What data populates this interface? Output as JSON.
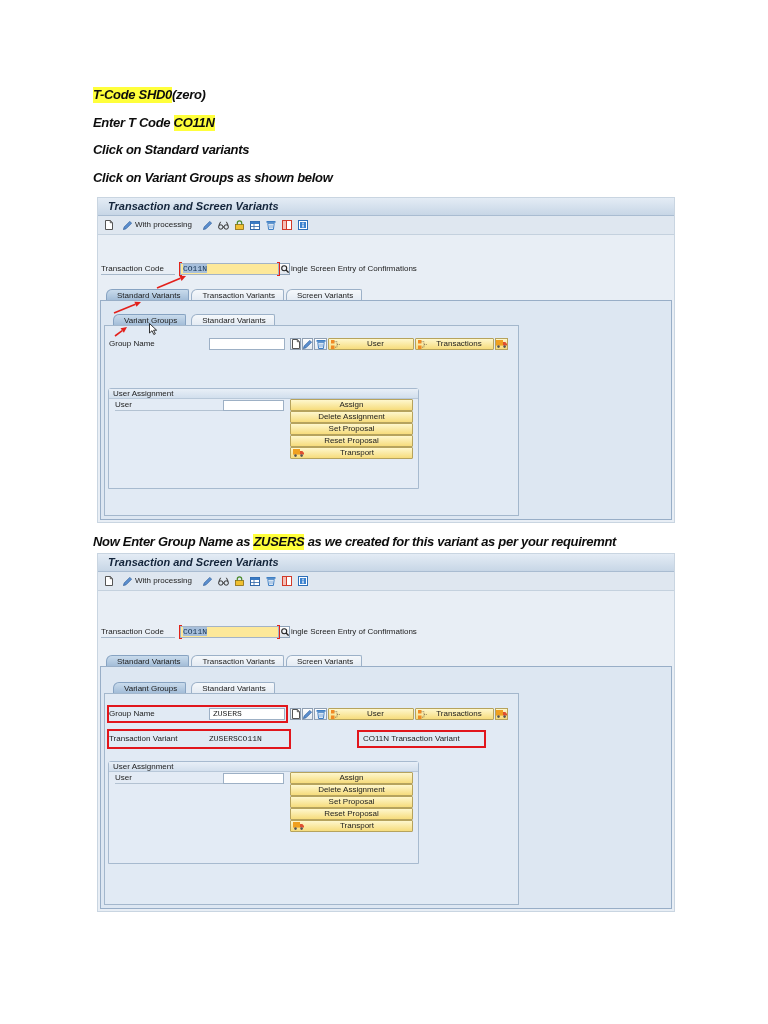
{
  "document": [
    {
      "kind": "instruction",
      "segments": [
        {
          "text": "T-Code SHD0",
          "highlighted": true
        },
        {
          "text": "(zero)",
          "highlighted": false
        }
      ]
    },
    {
      "kind": "instruction",
      "segments": [
        {
          "text": "Enter T Code ",
          "highlighted": false
        },
        {
          "text": "CO11N",
          "highlighted": true
        }
      ]
    },
    {
      "kind": "instruction",
      "segments": [
        {
          "text": "Click on Standard variants",
          "highlighted": false
        }
      ]
    },
    {
      "kind": "instruction",
      "segments": [
        {
          "text": "Click on Variant Groups as shown below",
          "highlighted": false
        }
      ]
    },
    {
      "kind": "screenshot",
      "title": "Transaction and Screen Variants",
      "toolbar": {
        "processing_label": "With processing"
      },
      "transaction_code": {
        "label": "Transaction Code",
        "value": "CO11N",
        "value_selected": true,
        "focused": true,
        "description": "ingle Screen Entry of Confirmations"
      },
      "tabs": [
        {
          "label": "Standard Variants",
          "selected": true
        },
        {
          "label": "Transaction Variants",
          "selected": false
        },
        {
          "label": "Screen Variants",
          "selected": false
        }
      ],
      "subtabs": [
        {
          "label": "Variant Groups",
          "selected": true
        },
        {
          "label": "Standard Variants",
          "selected": false
        }
      ],
      "group_name": {
        "label": "Group Name"
      },
      "group_buttons": [
        {
          "label": "User"
        },
        {
          "label": "Transactions"
        }
      ],
      "user_assignment": {
        "title": "User Assignment",
        "user_label": "User",
        "buttons": [
          {
            "label": "Assign",
            "kind": "text"
          },
          {
            "label": "Delete Assignment",
            "kind": "text"
          },
          {
            "label": "Set Proposal",
            "kind": "text"
          },
          {
            "label": "Reset Proposal",
            "kind": "text"
          },
          {
            "label": "Transport",
            "kind": "transport"
          }
        ]
      },
      "annotation_arrows": true,
      "mouse_pointer": true
    },
    {
      "kind": "instruction",
      "segments": [
        {
          "text": "Now Enter Group Name as ",
          "highlighted": false
        },
        {
          "text": "ZUSERS",
          "highlighted": true
        },
        {
          "text": " as we created for this variant as per your requiremnt",
          "highlighted": false
        }
      ]
    },
    {
      "kind": "screenshot",
      "title": "Transaction and Screen Variants",
      "toolbar": {
        "processing_label": "With processing"
      },
      "transaction_code": {
        "label": "Transaction Code",
        "value": "CO11N",
        "value_selected": true,
        "focused": true,
        "description": "ingle Screen Entry of Confirmations"
      },
      "tabs": [
        {
          "label": "Standard Variants",
          "selected": true
        },
        {
          "label": "Transaction Variants",
          "selected": false
        },
        {
          "label": "Screen Variants",
          "selected": false
        }
      ],
      "subtabs": [
        {
          "label": "Variant Groups",
          "selected": true
        },
        {
          "label": "Standard Variants",
          "selected": false
        }
      ],
      "group_name": {
        "label": "Group Name",
        "value": "ZUSERS",
        "framed": true
      },
      "group_buttons": [
        {
          "label": "User"
        },
        {
          "label": "Transactions"
        }
      ],
      "transaction_variant": {
        "label": "Transaction Variant",
        "value": "ZUSERSCO11N",
        "framed": true
      },
      "variant_description": {
        "text": "CO11N Transaction Variant",
        "framed": true
      },
      "user_assignment": {
        "title": "User Assignment",
        "user_label": "User",
        "buttons": [
          {
            "label": "Assign",
            "kind": "text"
          },
          {
            "label": "Delete Assignment",
            "kind": "text"
          },
          {
            "label": "Set Proposal",
            "kind": "text"
          },
          {
            "label": "Reset Proposal",
            "kind": "text"
          },
          {
            "label": "Transport",
            "kind": "transport"
          }
        ]
      }
    }
  ]
}
